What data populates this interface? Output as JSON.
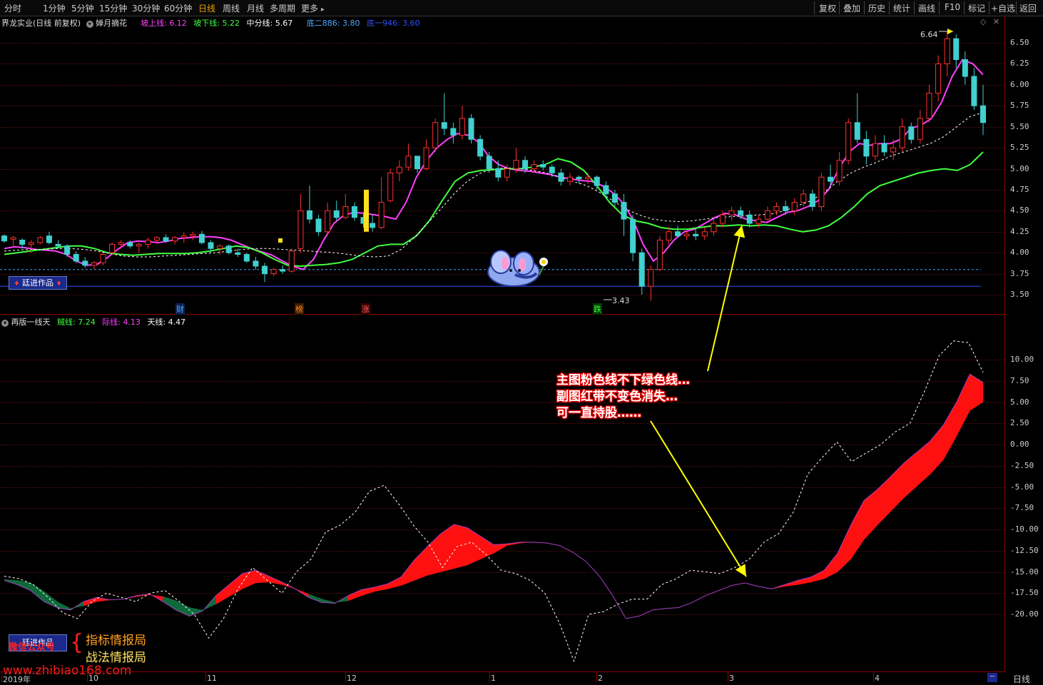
{
  "toolbar": {
    "periods": [
      "分时",
      "1分钟",
      "5分钟",
      "15分钟",
      "30分钟",
      "60分钟",
      "日线",
      "周线",
      "月线",
      "多周期",
      "更多"
    ],
    "active_period": "日线",
    "right_buttons": [
      "复权",
      "叠加",
      "历史",
      "统计",
      "画线",
      "F10",
      "标记",
      "+自选",
      "返回"
    ]
  },
  "main_info": {
    "stock": "界龙实业(日线 前复权)",
    "indicator": "婵月摘花",
    "line1_label": "坡上线:",
    "line1_value": "6.12",
    "line2_label": "坡下线:",
    "line2_value": "5.22",
    "line3_label": "中分线:",
    "line3_value": "5.67",
    "line4_label": "底二886:",
    "line4_value": "3.80",
    "line5_label": "底一946:",
    "line5_value": "3.60",
    "colors": {
      "line1": "#ff40ff",
      "line2": "#40ff40",
      "line3": "#ffffff",
      "line4": "#4aa8ff",
      "line5": "#3050ff"
    }
  },
  "sub_info": {
    "indicator": "再版一线天",
    "l1_label": "贼线:",
    "l1_value": "7.24",
    "l2_label": "际线:",
    "l2_value": "4.13",
    "l3_label": "天线:",
    "l3_value": "4.47"
  },
  "price_axis": [
    "6.50",
    "6.25",
    "6.00",
    "5.75",
    "5.50",
    "5.25",
    "5.00",
    "4.75",
    "4.50",
    "4.25",
    "4.00",
    "3.75",
    "3.50"
  ],
  "sub_axis": [
    "10.00",
    "7.50",
    "5.00",
    "2.50",
    "0.00",
    "-2.50",
    "-5.00",
    "-7.50",
    "-10.00",
    "-12.50",
    "-15.00",
    "-17.50",
    "-20.00"
  ],
  "markers": {
    "high": "6.64",
    "low": "3.43",
    "event_labels": [
      "财",
      "榜",
      "涨",
      "跌"
    ]
  },
  "x_axis": [
    "2019年",
    "10",
    "11",
    "12",
    "1",
    "2",
    "3",
    "4"
  ],
  "x_axis_end": "日线",
  "brand": {
    "box_label": "廷进作品",
    "box_label_sub": "廷进作品",
    "wechat": "微信公众号",
    "line1": "指标情报局",
    "line2": "战法情报局",
    "url": "www.zhibiao168.com"
  },
  "annotation": {
    "line1": "主图粉色线不下绿色线…",
    "line2": "副图红带不变色消失…",
    "line3": "可一直持股……"
  },
  "chart_data": {
    "type": "candlestick",
    "title": "",
    "ylim": [
      3.4,
      6.6
    ],
    "sub_ylim": [
      -23,
      13
    ],
    "candles": [
      [
        4.2,
        4.22,
        4.12,
        4.14
      ],
      [
        4.16,
        4.2,
        4.08,
        4.18
      ],
      [
        4.15,
        4.17,
        4.05,
        4.1
      ],
      [
        4.1,
        4.15,
        4.0,
        4.12
      ],
      [
        4.12,
        4.2,
        4.1,
        4.18
      ],
      [
        4.2,
        4.25,
        4.1,
        4.12
      ],
      [
        4.1,
        4.15,
        4.05,
        4.08
      ],
      [
        4.08,
        4.1,
        3.95,
        3.98
      ],
      [
        3.98,
        4.02,
        3.88,
        3.9
      ],
      [
        3.9,
        3.95,
        3.82,
        3.85
      ],
      [
        3.85,
        3.9,
        3.8,
        3.88
      ],
      [
        3.88,
        4.0,
        3.85,
        3.98
      ],
      [
        4.0,
        4.12,
        3.98,
        4.1
      ],
      [
        4.1,
        4.15,
        4.05,
        4.12
      ],
      [
        4.12,
        4.15,
        4.05,
        4.08
      ],
      [
        4.08,
        4.12,
        4.0,
        4.1
      ],
      [
        4.1,
        4.18,
        4.05,
        4.15
      ],
      [
        4.15,
        4.2,
        4.1,
        4.18
      ],
      [
        4.18,
        4.22,
        4.12,
        4.14
      ],
      [
        4.14,
        4.2,
        4.1,
        4.18
      ],
      [
        4.18,
        4.24,
        4.12,
        4.2
      ],
      [
        4.2,
        4.25,
        4.15,
        4.22
      ],
      [
        4.22,
        4.26,
        4.1,
        4.12
      ],
      [
        4.12,
        4.15,
        4.0,
        4.05
      ],
      [
        4.05,
        4.1,
        3.98,
        4.08
      ],
      [
        4.08,
        4.1,
        3.98,
        4.0
      ],
      [
        4.0,
        4.05,
        3.95,
        3.98
      ],
      [
        3.98,
        4.0,
        3.88,
        3.9
      ],
      [
        3.9,
        3.95,
        3.8,
        3.84
      ],
      [
        3.84,
        3.88,
        3.65,
        3.75
      ],
      [
        3.75,
        3.82,
        3.72,
        3.8
      ],
      [
        3.8,
        3.85,
        3.75,
        3.78
      ],
      [
        3.78,
        4.05,
        3.76,
        4.02
      ],
      [
        4.05,
        4.7,
        4.0,
        4.5
      ],
      [
        4.5,
        4.8,
        4.35,
        4.4
      ],
      [
        4.4,
        4.45,
        4.2,
        4.25
      ],
      [
        4.25,
        4.6,
        4.2,
        4.5
      ],
      [
        4.5,
        4.62,
        4.38,
        4.42
      ],
      [
        4.42,
        4.7,
        4.4,
        4.55
      ],
      [
        4.55,
        4.6,
        4.38,
        4.42
      ],
      [
        4.42,
        4.48,
        4.3,
        4.35
      ],
      [
        4.35,
        4.45,
        4.25,
        4.3
      ],
      [
        4.3,
        4.9,
        4.28,
        4.6
      ],
      [
        4.62,
        5.0,
        4.6,
        4.95
      ],
      [
        4.95,
        5.1,
        4.85,
        5.02
      ],
      [
        5.02,
        5.3,
        4.98,
        5.15
      ],
      [
        5.15,
        5.1,
        4.95,
        5.0
      ],
      [
        5.0,
        5.35,
        4.98,
        5.25
      ],
      [
        5.25,
        5.6,
        5.2,
        5.55
      ],
      [
        5.55,
        5.9,
        5.4,
        5.48
      ],
      [
        5.48,
        5.55,
        5.3,
        5.4
      ],
      [
        5.4,
        5.75,
        5.35,
        5.6
      ],
      [
        5.6,
        5.65,
        5.3,
        5.35
      ],
      [
        5.35,
        5.4,
        5.1,
        5.15
      ],
      [
        5.15,
        5.2,
        4.95,
        5.0
      ],
      [
        5.0,
        5.1,
        4.85,
        4.9
      ],
      [
        4.9,
        5.05,
        4.85,
        5.0
      ],
      [
        5.0,
        5.25,
        4.95,
        5.1
      ],
      [
        5.1,
        5.15,
        4.95,
        5.0
      ],
      [
        5.0,
        5.1,
        4.95,
        5.05
      ],
      [
        5.05,
        5.1,
        4.98,
        5.02
      ],
      [
        5.02,
        5.05,
        4.9,
        4.95
      ],
      [
        4.95,
        5.0,
        4.8,
        4.85
      ],
      [
        4.85,
        4.95,
        4.8,
        4.9
      ],
      [
        4.9,
        4.92,
        4.82,
        4.88
      ],
      [
        4.88,
        4.95,
        4.82,
        4.9
      ],
      [
        4.9,
        4.92,
        4.75,
        4.8
      ],
      [
        4.8,
        4.85,
        4.65,
        4.7
      ],
      [
        4.7,
        4.75,
        4.55,
        4.6
      ],
      [
        4.6,
        4.7,
        4.2,
        4.4
      ],
      [
        4.4,
        4.45,
        3.9,
        4.0
      ],
      [
        4.0,
        4.05,
        3.5,
        3.6
      ],
      [
        3.6,
        3.85,
        3.43,
        3.8
      ],
      [
        3.8,
        4.2,
        3.78,
        4.15
      ],
      [
        4.15,
        4.3,
        4.1,
        4.25
      ],
      [
        4.25,
        4.32,
        4.18,
        4.2
      ],
      [
        4.2,
        4.25,
        4.15,
        4.22
      ],
      [
        4.22,
        4.28,
        4.15,
        4.2
      ],
      [
        4.2,
        4.3,
        4.15,
        4.25
      ],
      [
        4.25,
        4.4,
        4.2,
        4.35
      ],
      [
        4.35,
        4.5,
        4.3,
        4.45
      ],
      [
        4.45,
        4.55,
        4.38,
        4.5
      ],
      [
        4.5,
        4.55,
        4.4,
        4.45
      ],
      [
        4.45,
        4.5,
        4.3,
        4.35
      ],
      [
        4.35,
        4.45,
        4.3,
        4.4
      ],
      [
        4.4,
        4.55,
        4.38,
        4.5
      ],
      [
        4.5,
        4.6,
        4.45,
        4.55
      ],
      [
        4.55,
        4.62,
        4.45,
        4.5
      ],
      [
        4.5,
        4.65,
        4.45,
        4.6
      ],
      [
        4.6,
        4.75,
        4.55,
        4.7
      ],
      [
        4.7,
        4.75,
        4.5,
        4.55
      ],
      [
        4.55,
        4.95,
        4.5,
        4.9
      ],
      [
        4.9,
        5.05,
        4.8,
        4.85
      ],
      [
        4.85,
        5.2,
        4.8,
        5.1
      ],
      [
        5.1,
        5.6,
        5.05,
        5.55
      ],
      [
        5.55,
        5.9,
        5.3,
        5.35
      ],
      [
        5.35,
        5.45,
        5.05,
        5.15
      ],
      [
        5.15,
        5.4,
        5.1,
        5.3
      ],
      [
        5.3,
        5.4,
        5.15,
        5.2
      ],
      [
        5.2,
        5.35,
        5.1,
        5.25
      ],
      [
        5.25,
        5.6,
        5.2,
        5.5
      ],
      [
        5.5,
        5.55,
        5.3,
        5.35
      ],
      [
        5.35,
        5.7,
        5.3,
        5.6
      ],
      [
        5.6,
        6.0,
        5.55,
        5.9
      ],
      [
        5.9,
        6.35,
        5.8,
        6.25
      ],
      [
        6.25,
        6.64,
        6.1,
        6.55
      ],
      [
        6.55,
        6.6,
        6.2,
        6.3
      ],
      [
        6.3,
        6.4,
        6.0,
        6.1
      ],
      [
        6.1,
        6.2,
        5.7,
        5.75
      ],
      [
        5.75,
        6.0,
        5.4,
        5.55
      ]
    ],
    "series": [
      {
        "name": "坡上线",
        "values": [
          4.05,
          4.07,
          4.06,
          4.04,
          4.03,
          4.02,
          3.98,
          3.9,
          3.85,
          3.86,
          3.94,
          4.04,
          4.12,
          4.14,
          4.13,
          4.12,
          4.14,
          4.17,
          4.18,
          4.19,
          4.19,
          4.18,
          4.15,
          4.1,
          4.05,
          4.01,
          3.97,
          3.9,
          3.84,
          3.8,
          3.92,
          4.15,
          4.35,
          4.45,
          4.48,
          4.47,
          4.45,
          4.43,
          4.4,
          4.6,
          4.9,
          5.1,
          5.25,
          5.35,
          5.42,
          5.4,
          5.32,
          5.15,
          5.05,
          5.0,
          4.98,
          4.97,
          4.95,
          4.93,
          4.9,
          4.88,
          4.86,
          4.85,
          4.8,
          4.72,
          4.6,
          4.4,
          4.1,
          3.9,
          4.0,
          4.15,
          4.25,
          4.28,
          4.35,
          4.42,
          4.47,
          4.45,
          4.4,
          4.38,
          4.36,
          4.42,
          4.48,
          4.5,
          4.55,
          4.62,
          4.75,
          5.0,
          5.2,
          5.3,
          5.28,
          5.3,
          5.3,
          5.35,
          5.48,
          5.52,
          5.6,
          5.8,
          6.1,
          6.3,
          6.25,
          6.12
        ]
      },
      {
        "name": "坡下线",
        "values": [
          3.98,
          4.0,
          4.02,
          4.04,
          4.06,
          4.08,
          4.08,
          4.05,
          4.0,
          3.98,
          3.97,
          3.98,
          3.99,
          3.99,
          3.99,
          4.0,
          4.02,
          4.05,
          4.08,
          4.06,
          4.0,
          3.92,
          3.85,
          3.84,
          3.85,
          3.86,
          3.88,
          3.92,
          4.0,
          4.08,
          4.1,
          4.1,
          4.2,
          4.38,
          4.62,
          4.85,
          4.95,
          4.98,
          4.99,
          5.0,
          5.0,
          5.02,
          5.05,
          5.12,
          5.08,
          4.98,
          4.8,
          4.6,
          4.45,
          4.38,
          4.35,
          4.3,
          4.28,
          4.28,
          4.3,
          4.32,
          4.32,
          4.33,
          4.32,
          4.33,
          4.32,
          4.28,
          4.25,
          4.27,
          4.32,
          4.42,
          4.55,
          4.7,
          4.8,
          4.85,
          4.9,
          4.95,
          4.98,
          5.0,
          4.98,
          5.05,
          5.2
        ]
      },
      {
        "name": "中分线",
        "values": [
          4.02,
          4.03,
          4.04,
          4.04,
          4.05,
          4.05,
          4.04,
          4.02,
          3.99,
          3.96,
          3.95,
          3.95,
          3.96,
          3.97,
          3.98,
          3.99,
          4.0,
          4.02,
          4.04,
          4.05,
          4.05,
          4.04,
          4.03,
          4.02,
          4.01,
          4.0,
          3.98,
          3.96,
          3.95,
          3.96,
          4.04,
          4.18,
          4.35,
          4.52,
          4.7,
          4.85,
          4.95,
          5.0,
          5.01,
          5.0,
          4.98,
          4.95,
          4.9,
          4.85,
          4.8,
          4.72,
          4.62,
          4.52,
          4.45,
          4.4,
          4.38,
          4.37,
          4.38,
          4.4,
          4.42,
          4.43,
          4.44,
          4.45,
          4.46,
          4.5,
          4.56,
          4.62,
          4.72,
          4.85,
          4.95,
          5.02,
          5.08,
          5.15,
          5.2,
          5.25,
          5.3,
          5.38,
          5.5,
          5.62,
          5.67
        ]
      }
    ],
    "sub_series": [
      {
        "name": "贼线",
        "values": [
          -16,
          -16.5,
          -17.2,
          -18.5,
          -19.2,
          -19.5,
          -18.5,
          -18,
          -18.3,
          -18.2,
          -17.8,
          -17.6,
          -18.5,
          -19.5,
          -20.2,
          -19.6,
          -17.8,
          -16.5,
          -15.2,
          -14.8,
          -15.5,
          -16.2,
          -17,
          -18,
          -18.6,
          -18.7,
          -17.8,
          -17.1,
          -16.8,
          -16.4,
          -15.6,
          -13.6,
          -12,
          -10.5,
          -9.4,
          -9.8,
          -10.8,
          -11.8,
          -11.7,
          -11.5,
          -11.5,
          -11.6,
          -11.9,
          -12.7,
          -13.8,
          -15.5,
          -17.8,
          -20.5,
          -20.2,
          -19.5,
          -19.3,
          -19.2,
          -18.6,
          -17.8,
          -17.2,
          -16.6,
          -16.3,
          -16.7,
          -17.0,
          -16.5,
          -16.0,
          -15.6,
          -14.8,
          -12.8,
          -9.5,
          -6.6,
          -5.3,
          -3.8,
          -2.2,
          -0.9,
          0.4,
          2.3,
          5,
          8.3,
          7.3
        ]
      },
      {
        "name": "际线",
        "values": [
          -15.9,
          -16.0,
          -16.3,
          -17.3,
          -18.5,
          -19.3,
          -19.0,
          -18.5,
          -18.3,
          -18.2,
          -17.9,
          -17.7,
          -17.9,
          -18.4,
          -19.2,
          -19.5,
          -18.8,
          -17.9,
          -17.0,
          -16.3,
          -16.2,
          -16.5,
          -17.0,
          -17.6,
          -18.2,
          -18.6,
          -18.4,
          -17.8,
          -17.3,
          -17.0,
          -16.6,
          -16.0,
          -15.4,
          -15.0,
          -14.6,
          -14.2,
          -13.5,
          -12.8,
          -11.9,
          -11.6,
          -11.5,
          -11.6,
          -11.9,
          -12.7,
          -13.8,
          -15.5,
          -17.8,
          -20.5,
          -20.2,
          -19.5,
          -19.3,
          -19.2,
          -18.6,
          -17.8,
          -17.2,
          -16.6,
          -16.3,
          -16.7,
          -17.0,
          -16.7,
          -16.5,
          -16.2,
          -15.8,
          -15.0,
          -13.5,
          -11.2,
          -9.5,
          -7.9,
          -6.3,
          -4.9,
          -3.5,
          -1.8,
          1.0,
          4.0,
          5.0
        ]
      },
      {
        "name": "天线",
        "values": [
          -15.5,
          -15.8,
          -16.5,
          -18,
          -19.8,
          -20.5,
          -18.5,
          -17.5,
          -18,
          -18.5,
          -17.5,
          -17.2,
          -18.5,
          -20,
          -22.8,
          -20.5,
          -17,
          -14.5,
          -16,
          -17.5,
          -15,
          -13.5,
          -10.3,
          -9.5,
          -8,
          -5.5,
          -4.8,
          -7,
          -9.5,
          -11.5,
          -14.5,
          -12,
          -11.5,
          -13,
          -14.8,
          -15.2,
          -16,
          -17.5,
          -21,
          -25.5,
          -20,
          -19.7,
          -18.8,
          -18.2,
          -18.2,
          -16.5,
          -15.8,
          -14.8,
          -15,
          -15.2,
          -14.5,
          -13.5,
          -11.5,
          -10.5,
          -8,
          -3.5,
          -1.5,
          0.3,
          -2.0,
          -1.0,
          0.0,
          1.5,
          2.5,
          6.3,
          10.5,
          12.2,
          12.0,
          8.5
        ]
      }
    ]
  }
}
